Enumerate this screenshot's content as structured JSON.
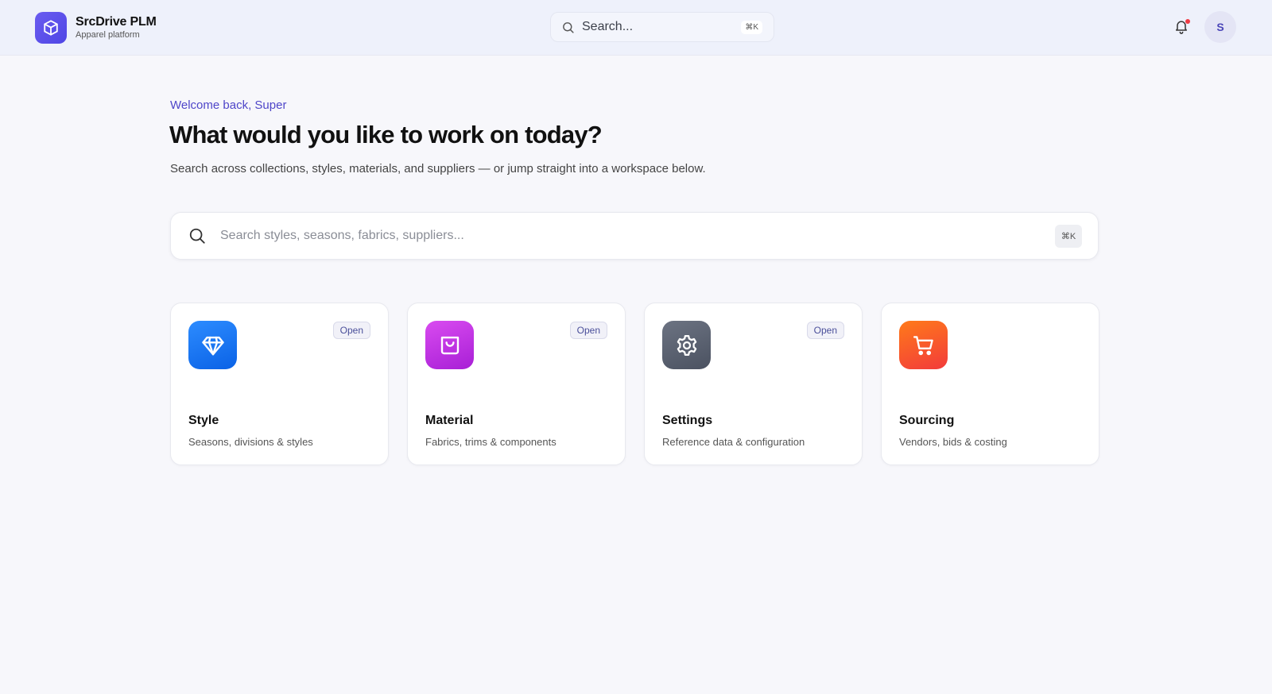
{
  "header": {
    "brand_title": "SrcDrive PLM",
    "brand_subtitle": "Apparel platform",
    "search_placeholder": "Search...",
    "search_shortcut": "⌘K",
    "avatar_initial": "S",
    "notification_dot": true
  },
  "hero": {
    "welcome": "Welcome back, Super",
    "headline": "What would you like to work on today?",
    "subline": "Search across collections, styles, materials, and suppliers — or jump straight into a workspace below.",
    "search_placeholder": "Search styles, seasons, fabrics, suppliers...",
    "search_shortcut": "⌘K"
  },
  "cards": [
    {
      "title": "Style",
      "description": "Seasons, divisions & styles",
      "badge": "Open",
      "icon": "diamond-icon",
      "color_from": "#2d8cff",
      "color_to": "#0a62e6"
    },
    {
      "title": "Material",
      "description": "Fabrics, trims & components",
      "badge": "Open",
      "icon": "shopping-bag-icon",
      "color_from": "#d94bf0",
      "color_to": "#a81fd6"
    },
    {
      "title": "Settings",
      "description": "Reference data & configuration",
      "badge": "Open",
      "icon": "gear-icon",
      "color_from": "#6c7382",
      "color_to": "#4b5261"
    },
    {
      "title": "Sourcing",
      "description": "Vendors, bids & costing",
      "badge": "",
      "icon": "shopping-cart-icon",
      "color_from": "#ff7a1a",
      "color_to": "#f23b3b"
    }
  ],
  "colors": {
    "accent": "#4f46e5",
    "welcome_text": "#4f46c9",
    "notification": "#ef3b44"
  }
}
